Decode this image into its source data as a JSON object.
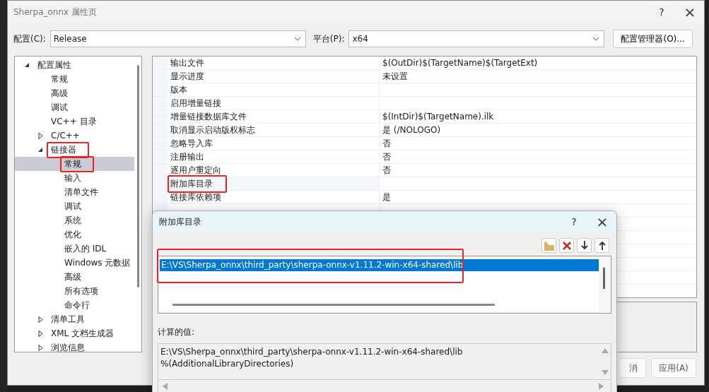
{
  "window": {
    "title": "Sherpa_onnx 属性页",
    "help": "?",
    "close": "×"
  },
  "config": {
    "label": "配置(C):",
    "value": "Release"
  },
  "platform": {
    "label": "平台(P):",
    "value": "x64"
  },
  "config_manager_button": "配置管理器(O)...",
  "tree": [
    {
      "label": "配置属性",
      "expanded": true,
      "selected": false,
      "highlighted": false,
      "children": [
        {
          "label": "常规",
          "selected": false,
          "highlighted": false
        },
        {
          "label": "高级",
          "selected": false,
          "highlighted": false
        },
        {
          "label": "调试",
          "selected": false,
          "highlighted": false
        },
        {
          "label": "VC++ 目录",
          "selected": false,
          "highlighted": false
        },
        {
          "label": "C/C++",
          "expanded": false,
          "selected": false,
          "highlighted": false
        },
        {
          "label": "链接器",
          "expanded": true,
          "selected": false,
          "highlighted": true,
          "children": [
            {
              "label": "常规",
              "selected": true,
              "highlighted": true
            },
            {
              "label": "输入",
              "selected": false,
              "highlighted": false
            },
            {
              "label": "清单文件",
              "selected": false,
              "highlighted": false
            },
            {
              "label": "调试",
              "selected": false,
              "highlighted": false
            },
            {
              "label": "系统",
              "selected": false,
              "highlighted": false
            },
            {
              "label": "优化",
              "selected": false,
              "highlighted": false
            },
            {
              "label": "嵌入的 IDL",
              "selected": false,
              "highlighted": false
            },
            {
              "label": "Windows 元数据",
              "selected": false,
              "highlighted": false
            },
            {
              "label": "高级",
              "selected": false,
              "highlighted": false
            },
            {
              "label": "所有选项",
              "selected": false,
              "highlighted": false
            },
            {
              "label": "命令行",
              "selected": false,
              "highlighted": false
            }
          ]
        },
        {
          "label": "清单工具",
          "expanded": false,
          "selected": false,
          "highlighted": false
        },
        {
          "label": "XML 文档生成器",
          "expanded": false,
          "selected": false,
          "highlighted": false
        },
        {
          "label": "浏览信息",
          "expanded": false,
          "selected": false,
          "highlighted": false
        }
      ]
    }
  ],
  "properties": [
    {
      "name": "输出文件",
      "value": "$(OutDir)$(TargetName)$(TargetExt)",
      "highlighted": false
    },
    {
      "name": "显示进度",
      "value": "未设置",
      "highlighted": false
    },
    {
      "name": "版本",
      "highlighted": false
    },
    {
      "name": "启用增量链接",
      "highlighted": false
    },
    {
      "name": "增量链接数据库文件",
      "value": "$(IntDir)$(TargetName).ilk",
      "highlighted": false
    },
    {
      "name": "取消显示启动版权标志",
      "value": "是 (/NOLOGO)",
      "highlighted": false
    },
    {
      "name": "忽略导入库",
      "value": "否",
      "highlighted": false
    },
    {
      "name": "注册输出",
      "value": "否",
      "highlighted": false
    },
    {
      "name": "逐用户重定向",
      "value": "否",
      "highlighted": false
    },
    {
      "name": "附加库目录",
      "highlighted": true
    },
    {
      "name": "链接库依赖项",
      "value": "是",
      "highlighted": false
    }
  ],
  "buttons": [
    {
      "label": "消"
    },
    {
      "label": "应用(A)"
    }
  ],
  "dialog": {
    "title": "附加库目录",
    "help": "?",
    "close": "×",
    "entries": [
      {
        "text": "E:\\VS\\Sherpa_onnx\\third_party\\sherpa-onnx-v1.11.2-win-x64-shared\\lib",
        "selected": true,
        "highlighted": true
      }
    ],
    "computed_label": "计算的值:",
    "computed_lines": [
      "E:\\VS\\Sherpa_onnx\\third_party\\sherpa-onnx-v1.11.2-win-x64-shared\\lib",
      "%(AdditionalLibraryDirectories)"
    ]
  }
}
